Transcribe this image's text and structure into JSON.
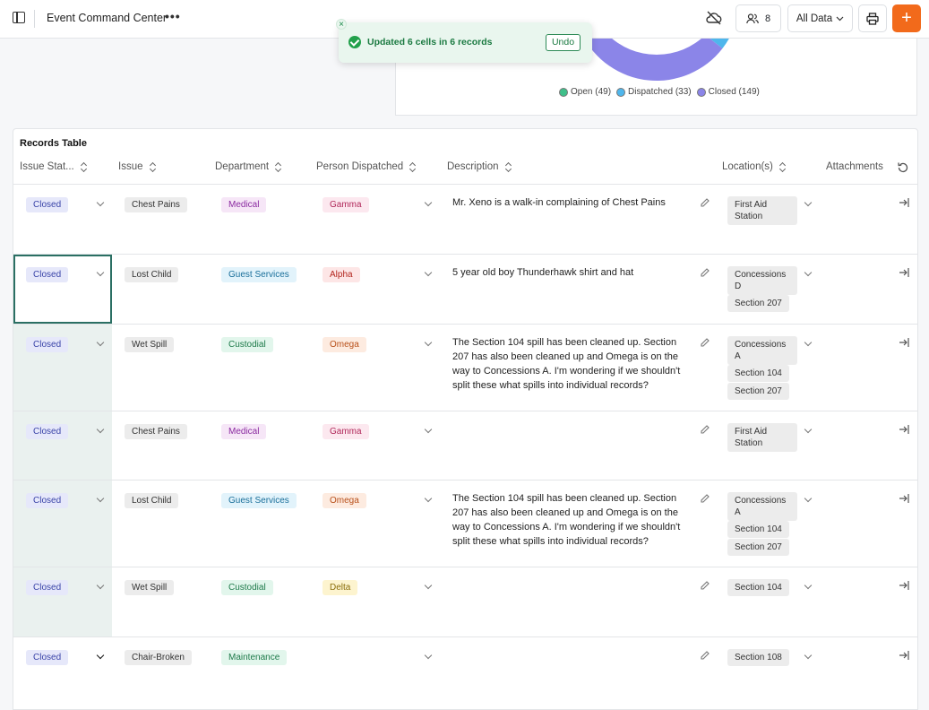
{
  "header": {
    "app_title": "Event Command Center",
    "more_label": "•••",
    "users_count": "8",
    "all_data_label": "All Data",
    "add_label": "+"
  },
  "toast": {
    "message": "Updated 6 cells in 6 records",
    "undo_label": "Undo",
    "close_label": "×"
  },
  "chart_data": {
    "type": "pie",
    "categories": [
      "Open",
      "Dispatched",
      "Closed"
    ],
    "values": [
      49,
      33,
      149
    ],
    "colors": [
      "#3fbf8a",
      "#4fb6ec",
      "#8b85e8"
    ],
    "legend": [
      {
        "label": "Open (49)",
        "color": "#3fbf8a"
      },
      {
        "label": "Dispatched (33)",
        "color": "#4fb6ec"
      },
      {
        "label": "Closed (149)",
        "color": "#8b85e8"
      }
    ],
    "legend_position": "bottom"
  },
  "table": {
    "title": "Records Table",
    "columns": [
      "Issue Stat...",
      "Issue",
      "Department",
      "Person Dispatched",
      "Description",
      "Location(s)",
      "Attachments"
    ],
    "rows": [
      {
        "status": "Closed",
        "issue": "Chest Pains",
        "department": "Medical",
        "person": "Gamma",
        "description": "Mr. Xeno is a walk-in complaining of Chest Pains",
        "locations": [
          "First Aid Station"
        ]
      },
      {
        "status": "Closed",
        "issue": "Lost Child",
        "department": "Guest Services",
        "person": "Alpha",
        "description": "5 year old boy Thunderhawk shirt and hat",
        "locations": [
          "Concessions D",
          "Section 207"
        ]
      },
      {
        "status": "Closed",
        "issue": "Wet Spill",
        "department": "Custodial",
        "person": "Omega",
        "description": "The Section 104 spill has been cleaned up.  Section 207 has also been cleaned up and Omega is on the way to Concessions A. I'm wondering if we shouldn't split these what spills into individual records?",
        "locations": [
          "Concessions A",
          "Section 104",
          "Section 207"
        ]
      },
      {
        "status": "Closed",
        "issue": "Chest Pains",
        "department": "Medical",
        "person": "Gamma",
        "description": "",
        "locations": [
          "First Aid Station"
        ]
      },
      {
        "status": "Closed",
        "issue": "Lost Child",
        "department": "Guest Services",
        "person": "Omega",
        "description": "The Section 104 spill has been cleaned up.  Section 207 has also been cleaned up and Omega is on the way to Concessions A. I'm wondering if we shouldn't split these what spills into individual records?",
        "locations": [
          "Concessions A",
          "Section 104",
          "Section 207"
        ]
      },
      {
        "status": "Closed",
        "issue": "Wet Spill",
        "department": "Custodial",
        "person": "Delta",
        "description": "",
        "locations": [
          "Section 104"
        ]
      },
      {
        "status": "Closed",
        "issue": "Chair-Broken",
        "department": "Maintenance",
        "person": "",
        "description": "",
        "locations": [
          "Section 108"
        ]
      }
    ]
  }
}
